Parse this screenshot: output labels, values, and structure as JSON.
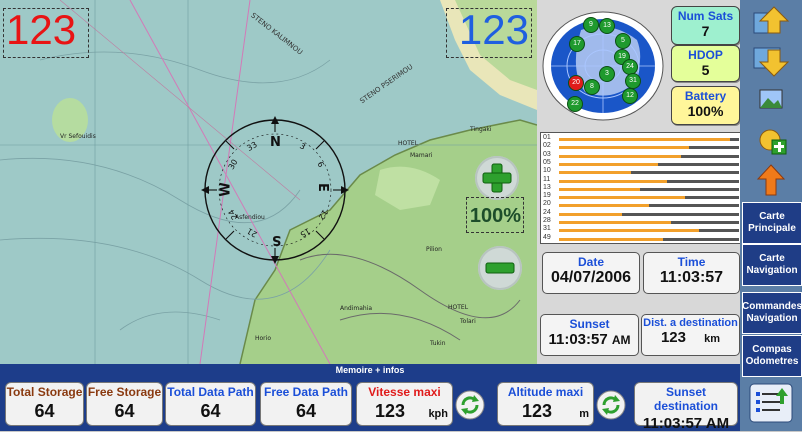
{
  "map": {
    "left_display": "123",
    "right_display": "123",
    "zoom_level": "100%",
    "labels": [
      "Vr Sefouidis",
      "STENO KALIMNOU",
      "STENO PSERIMOU",
      "HOTEL",
      "Mamari",
      "Tingaki",
      "Pilion",
      "Andimahia",
      "HOTEL",
      "Tolari",
      "Tukin",
      "Asfendiou",
      "Horio"
    ]
  },
  "compass": {
    "cardinals": {
      "N": "N",
      "E": "E",
      "S": "S",
      "W": "W"
    },
    "ticks": [
      "33",
      "30",
      "24",
      "21",
      "15",
      "12",
      "6",
      "3"
    ]
  },
  "gps": {
    "num_sats_label": "Num Sats",
    "num_sats_value": "7",
    "hdop_label": "HDOP",
    "hdop_value": "5",
    "battery_label": "Battery",
    "battery_value": "100%",
    "sat_ids": [
      "01",
      "02",
      "03",
      "05",
      "10",
      "11",
      "13",
      "19",
      "20",
      "24",
      "28",
      "31",
      "49"
    ],
    "sat_levels": [
      0.95,
      0.72,
      0.68,
      0.55,
      0.4,
      0.6,
      0.45,
      0.7,
      0.5,
      0.35,
      0.62,
      0.78,
      0.58
    ],
    "sky_sats": [
      "9",
      "13",
      "17",
      "19",
      "3",
      "24",
      "31",
      "8",
      "12",
      "22",
      "5",
      "20"
    ]
  },
  "info": {
    "date_label": "Date",
    "date_value": "04/07/2006",
    "time_label": "Time",
    "time_value": "11:03:57",
    "sunset_label": "Sunset",
    "sunset_value": "11:03:57",
    "sunset_ampm": "AM",
    "dist_label": "Dist. a destination",
    "dist_value": "123",
    "dist_unit": "km"
  },
  "sidebar": {
    "nav": [
      {
        "label": "Carte\nPrincipale"
      },
      {
        "label": "Carte\nNavigation"
      },
      {
        "label": "Commandes\nNavigation"
      },
      {
        "label": "Compas\nOdometres"
      }
    ]
  },
  "memo": {
    "title": "Memoire + infos",
    "items": [
      {
        "label": "Total Storage",
        "value": "64",
        "color": "#8a3a10"
      },
      {
        "label": "Free Storage",
        "value": "64",
        "color": "#8a3a10"
      },
      {
        "label": "Total Data Path",
        "value": "64",
        "color": "#1b4fd8"
      },
      {
        "label": "Free Data Path",
        "value": "64",
        "color": "#1b4fd8"
      },
      {
        "label": "Vitesse maxi",
        "value": "123",
        "unit": "kph",
        "color": "#e01b1b"
      },
      {
        "label": "Altitude maxi",
        "value": "123",
        "unit": "m",
        "color": "#1b4fd8"
      },
      {
        "label": "Sunset destination",
        "value": "11:03:57 AM",
        "color": "#1b4fd8"
      }
    ]
  },
  "colors": {
    "accent_blue": "#1b4fd8",
    "nav_blue": "#1f3d86",
    "sat_bar": "#f2a02b",
    "num_sats_bg": "#9ef0cf",
    "hdop_bg": "#e4ff9a",
    "battery_bg": "#fff69a"
  }
}
